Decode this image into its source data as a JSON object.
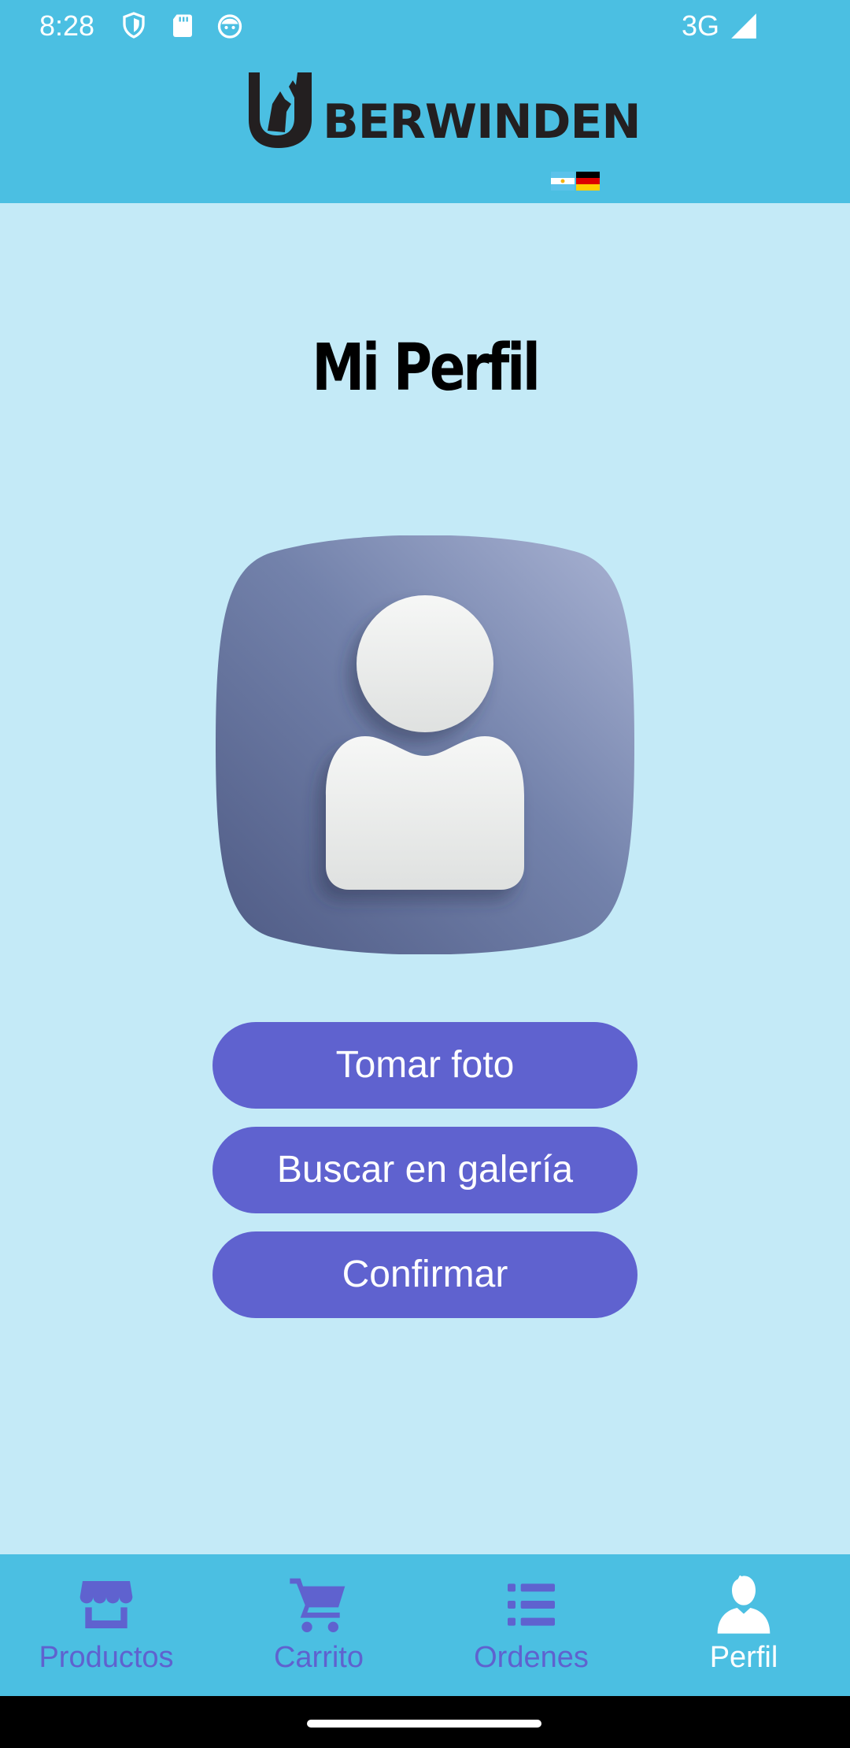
{
  "status_bar": {
    "time": "8:28",
    "network": "3G",
    "icons": [
      "shield-icon",
      "sd-card-icon",
      "notification-face-icon",
      "signal-icon"
    ]
  },
  "header": {
    "logo_text": "BERWINDEN",
    "logo_icon": "wolf-u-logo"
  },
  "main": {
    "title": "Mi Perfil",
    "avatar_icon": "user-avatar-icon",
    "buttons": {
      "take_photo": "Tomar foto",
      "gallery": "Buscar en galería",
      "confirm": "Confirmar"
    }
  },
  "bottom_nav": {
    "items": [
      {
        "label": "Productos",
        "icon": "store-icon"
      },
      {
        "label": "Carrito",
        "icon": "cart-icon"
      },
      {
        "label": "Ordenes",
        "icon": "list-icon"
      },
      {
        "label": "Perfil",
        "icon": "person-icon"
      }
    ],
    "active_index": 3
  },
  "colors": {
    "header": "#4bbfe2",
    "background": "#c4eaf7",
    "accent": "#5f62cf",
    "nav_active": "#ffffff"
  }
}
